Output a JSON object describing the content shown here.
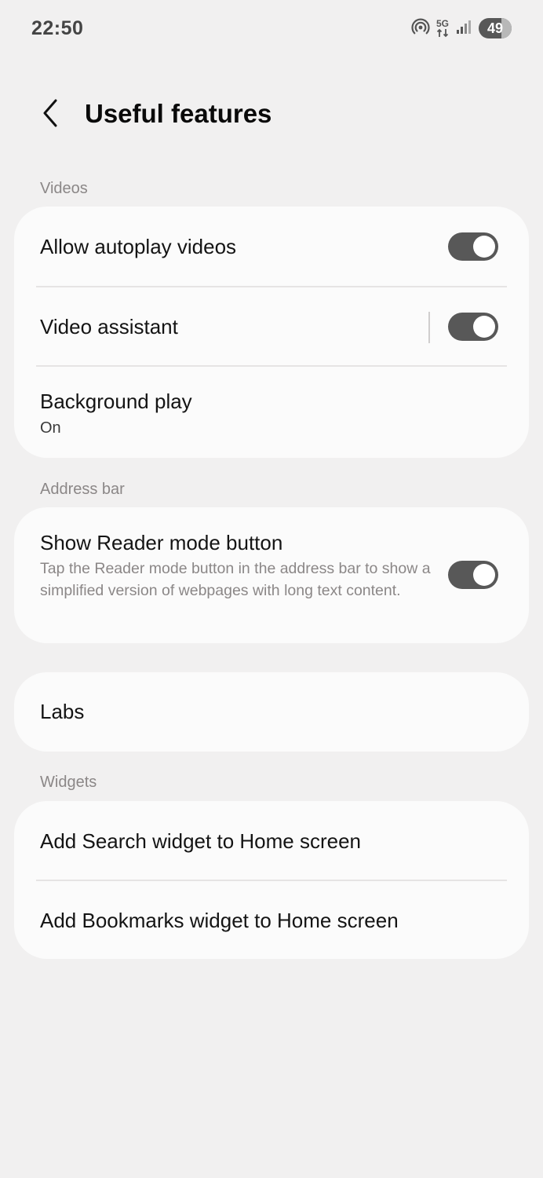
{
  "status_bar": {
    "time": "22:50",
    "network": "5G",
    "battery": "49",
    "icons": [
      "hotspot-icon",
      "5g-icon",
      "signal-icon",
      "battery-icon"
    ]
  },
  "header": {
    "title": "Useful features",
    "back_icon": "chevron-left-icon"
  },
  "sections": {
    "videos": {
      "label": "Videos",
      "items": [
        {
          "title": "Allow autoplay videos",
          "toggle": "on"
        },
        {
          "title": "Video assistant",
          "toggle": "on"
        },
        {
          "title": "Background play",
          "subtitle": "On"
        }
      ]
    },
    "address_bar": {
      "label": "Address bar",
      "items": [
        {
          "title": "Show Reader mode button",
          "description": "Tap the Reader mode button in the address bar to show a simplified version of webpages with long text content.",
          "toggle": "on"
        }
      ]
    },
    "labs": {
      "items": [
        {
          "title": "Labs"
        }
      ]
    },
    "widgets": {
      "label": "Widgets",
      "items": [
        {
          "title": "Add Search widget to Home screen"
        },
        {
          "title": "Add Bookmarks widget to Home screen"
        }
      ]
    }
  },
  "colors": {
    "background": "#f1f0f0",
    "card": "#fbfbfb",
    "toggle_on": "#585858",
    "section_label": "#8b8787"
  }
}
